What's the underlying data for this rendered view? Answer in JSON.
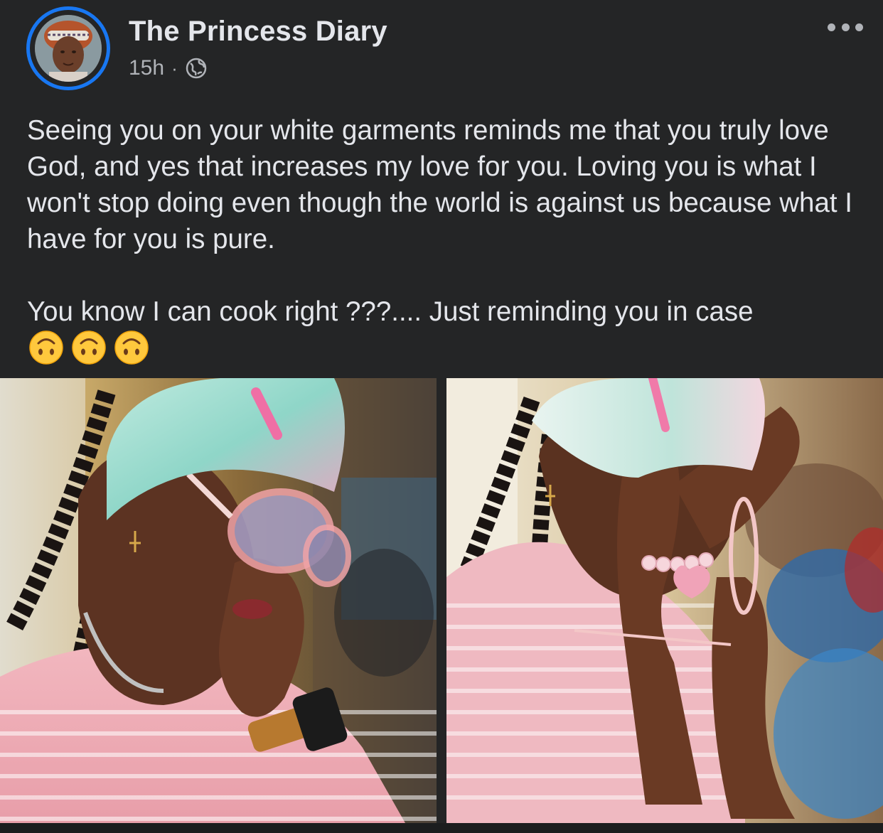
{
  "post": {
    "author": "The Princess Diary",
    "time": "15h",
    "separator": "·",
    "visibility_icon": "globe-icon",
    "more_icon": "more-options-icon",
    "paragraphs": [
      "Seeing you on your white garments reminds me that you truly love God, and yes that increases my love for you. Loving you is what I won't stop doing even though the world is against us because what I have for you is pure.",
      "You know I can cook right ???.... Just reminding you in case"
    ],
    "emojis": [
      "upside-down-face-emoji",
      "upside-down-face-emoji",
      "upside-down-face-emoji"
    ],
    "photos": [
      {
        "icon": "photo-woman-sunglasses"
      },
      {
        "icon": "photo-woman-covering-face"
      }
    ]
  },
  "colors": {
    "background": "#242526",
    "text_primary": "#e4e6eb",
    "text_secondary": "#b0b3b8",
    "story_ring": "#1877f2"
  }
}
